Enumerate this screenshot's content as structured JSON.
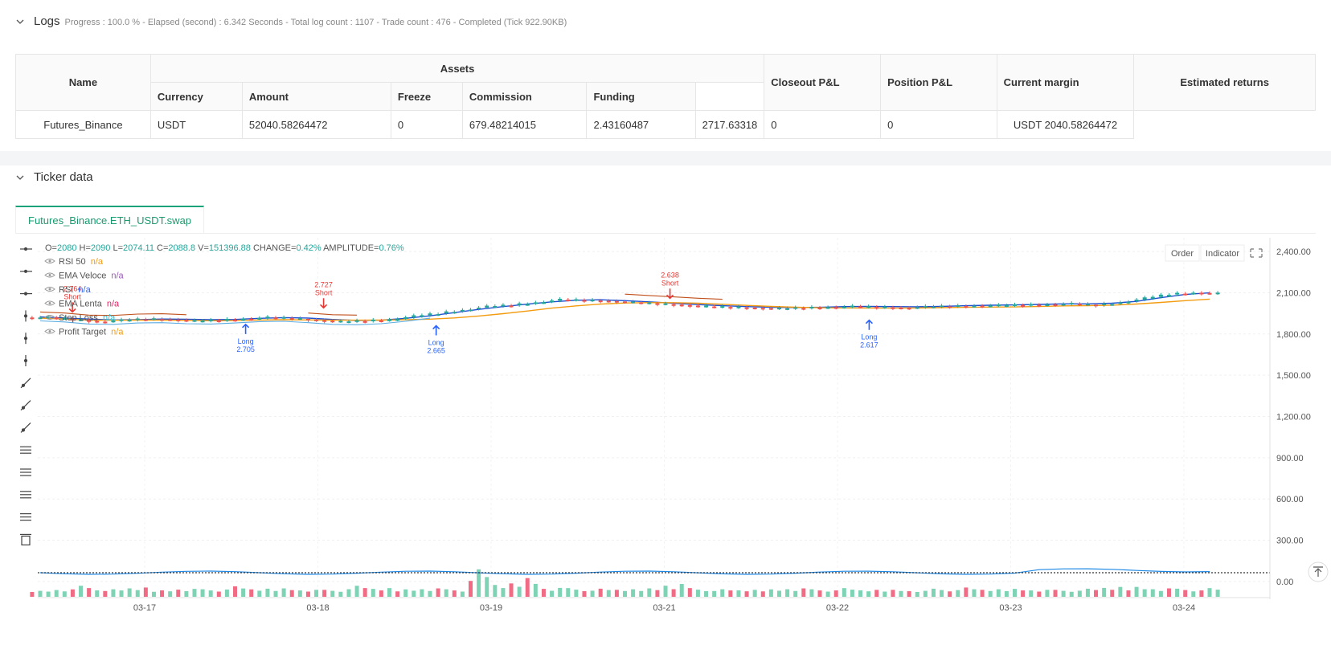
{
  "logs": {
    "title": "Logs",
    "status": "Progress : 100.0 % - Elapsed (second) : 6.342  Seconds - Total log count : 1107 - Trade count : 476 - Completed (Tick 922.90KB)"
  },
  "assets_table": {
    "group_header": "Assets",
    "headers": {
      "name": "Name",
      "currency": "Currency",
      "amount": "Amount",
      "freeze": "Freeze",
      "commission": "Commission",
      "funding": "Funding",
      "closeout": "Closeout P&L",
      "position": "Position P&L",
      "margin": "Current margin",
      "returns": "Estimated returns"
    },
    "row": {
      "name": "Futures_Binance",
      "currency": "USDT",
      "amount": "52040.58264472",
      "freeze": "0",
      "commission": "679.48214015",
      "funding": "2.43160487",
      "closeout": "2717.63318",
      "position": "0",
      "margin": "0",
      "returns": "USDT 2040.58264472"
    }
  },
  "ticker": {
    "title": "Ticker data",
    "tab": "Futures_Binance.ETH_USDT.swap",
    "buttons": {
      "order": "Order",
      "indicator": "Indicator"
    },
    "ohlc": {
      "o_label": "O=",
      "o": "2080",
      "h_label": "H=",
      "h": "2090",
      "l_label": "L=",
      "l": "2074.11",
      "c_label": "C=",
      "c": "2088.8",
      "v_label": "V=",
      "v": "151396.88",
      "change_label": "CHANGE=",
      "change": "0.42%",
      "amp_label": "AMPLITUDE=",
      "amp": "0.76%"
    },
    "legend": [
      {
        "name": "RSI 50",
        "value": "n/a",
        "color": "#f39c12"
      },
      {
        "name": "EMA Veloce",
        "value": "n/a",
        "color": "#9b59b6"
      },
      {
        "name": "RSI",
        "value": "n/a",
        "color": "#2962ff"
      },
      {
        "name": "EMA Lenta",
        "value": "n/a",
        "color": "#e91e63"
      },
      {
        "name": "Stop Loss",
        "value": "n/a",
        "color": "#26c6da"
      },
      {
        "name": "Profit Target",
        "value": "n/a",
        "color": "#f39c12"
      }
    ],
    "colors": {
      "up": "#26a69a",
      "down": "#ef5350",
      "ema_fast": "#1e4fd1",
      "ema_slow": "#f39c12",
      "stop": "#5dade2",
      "target": "#c0501c",
      "long": "#2962ff",
      "short": "#e53935"
    }
  },
  "chart_data": {
    "type": "candlestick",
    "y_ticks": [
      "2,400.00",
      "2,100.00",
      "1,800.00",
      "1,500.00",
      "1,200.00",
      "900.00",
      "600.00",
      "300.00",
      "0.00"
    ],
    "x_ticks": [
      "03-17",
      "03-18",
      "03-19",
      "03-21",
      "03-22",
      "03-23",
      "03-24"
    ],
    "ylim": [
      -100,
      2500
    ],
    "signals": [
      {
        "type": "Short",
        "value": "2.764",
        "price": 1960,
        "day": 0.2
      },
      {
        "type": "Long",
        "value": "2.705",
        "price": 1870,
        "day": 1.2
      },
      {
        "type": "Short",
        "value": "2.727",
        "price": 1990,
        "day": 1.65
      },
      {
        "type": "Long",
        "value": "2.665",
        "price": 1860,
        "day": 2.3
      },
      {
        "type": "Short",
        "value": "2.638",
        "price": 2060,
        "day": 3.65
      },
      {
        "type": "Long",
        "value": "2.617",
        "price": 1900,
        "day": 4.8
      }
    ],
    "price_path": [
      1920,
      1905,
      1890,
      1900,
      1910,
      1905,
      1895,
      1900,
      1910,
      1920,
      1915,
      1900,
      1890,
      1895,
      1905,
      1930,
      1950,
      1975,
      2000,
      2010,
      2030,
      2050,
      2045,
      2040,
      2030,
      2020,
      2010,
      2000,
      1995,
      1990,
      1985,
      1990,
      1995,
      2000,
      1995,
      1990,
      1998,
      2002,
      2005,
      2008,
      2010,
      2015,
      2020,
      2010,
      2030,
      2060,
      2090,
      2100,
      2095
    ],
    "volume_path": [
      20,
      35,
      60,
      30,
      45,
      25,
      40,
      30,
      55,
      35,
      45,
      30,
      25,
      60,
      40,
      35,
      45,
      30,
      200,
      80,
      150,
      50,
      40,
      35,
      30,
      45,
      90,
      40,
      30,
      25,
      35,
      45,
      30,
      40,
      25,
      30,
      20,
      35,
      45,
      30,
      40,
      30,
      25,
      35,
      50,
      60,
      45,
      35,
      40
    ]
  }
}
